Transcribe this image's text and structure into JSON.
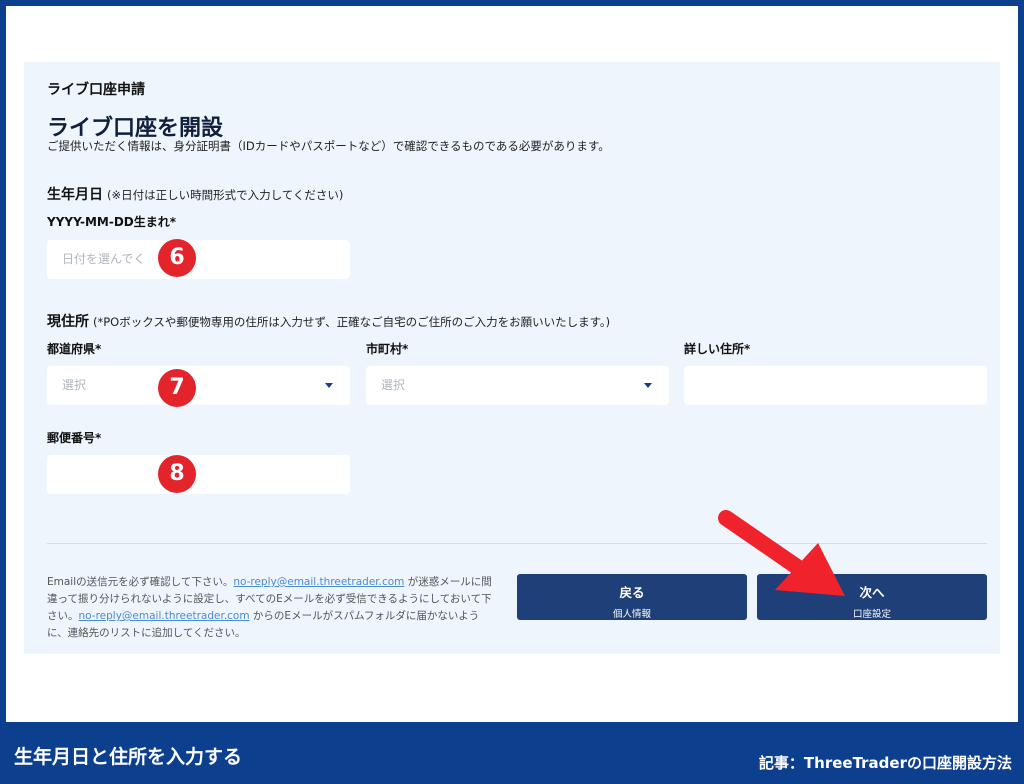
{
  "header": {
    "breadcrumb": "ライブ口座申請",
    "title": "ライブ口座を開設",
    "description": "ご提供いただく情報は、身分証明書（IDカードやパスポートなど）で確認できるものである必要があります。"
  },
  "birth": {
    "heading": "生年月日",
    "note": "(※日付は正しい時間形式で入力してください)",
    "label": "YYYY-MM-DD生まれ*",
    "placeholder": "日付を選んでく"
  },
  "address": {
    "heading": "現住所",
    "note": "(*POボックスや郵便物専用の住所は入力せず、正確なご自宅のご住所のご入力をお願いいたします。)",
    "prefecture_label": "都道府県*",
    "prefecture_placeholder": "選択",
    "city_label": "市町村*",
    "city_placeholder": "選択",
    "detail_label": "詳しい住所*",
    "detail_value": "",
    "postal_label": "郵便番号*",
    "postal_value": ""
  },
  "badges": [
    "6",
    "7",
    "8"
  ],
  "notice": {
    "part1": "Emailの送信元を必ず確認して下さい。",
    "email1": "no-reply@email.threetrader.com",
    "part2": " が迷惑メールに間違って振り分けられないように設定し、すべてのEメールを必ず受信できるようにしておいて下さい。",
    "email2": "no-reply@email.threetrader.com",
    "part3": " からのEメールがスパムフォルダに届かないように、連絡先のリストに追加してください。"
  },
  "buttons": {
    "back_label": "戻る",
    "back_sub": "個人情報",
    "next_label": "次へ",
    "next_sub": "口座設定"
  },
  "footer": {
    "caption": "生年月日と住所を入力する",
    "article": "記事：ThreeTraderの口座開設方法"
  },
  "colors": {
    "frame": "#0d3f8f",
    "panel": "#eef5fd",
    "button": "#1e3f78",
    "badge": "#e3242b",
    "arrow": "#f0222c"
  }
}
